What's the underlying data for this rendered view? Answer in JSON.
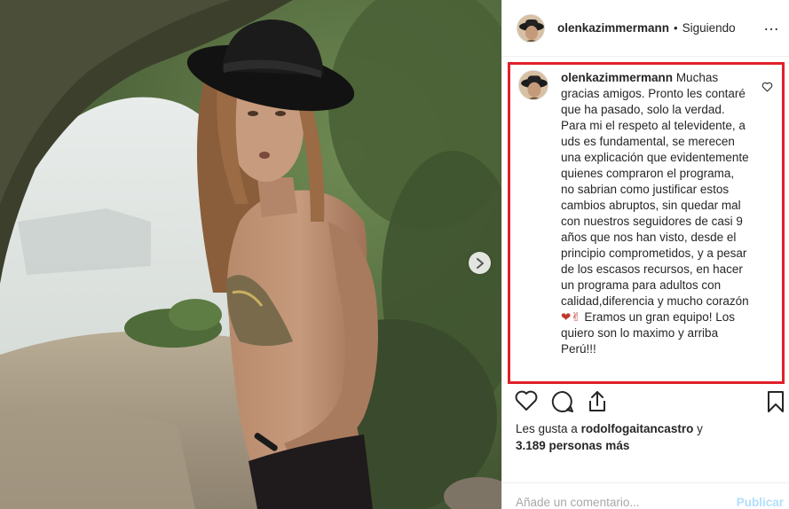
{
  "post": {
    "username": "olenkazimmermann",
    "separator": "•",
    "follow_status": "Siguiendo",
    "more_icon": "more-horizontal-icon"
  },
  "comment": {
    "username": "olenkazimmermann",
    "text_1": "Muchas gracias amigos. Pronto les contaré que ha pasado, solo la verdad. Para mi el respeto al televidente, a uds es fundamental, se merecen una explicación que evidentemente quienes compraron el programa, no sabrian como justificar estos cambios abruptos, sin quedar mal con nuestros seguidores de casi 9 años que nos han visto, desde el principio comprometidos, y a pesar de los escasos recursos, en hacer un programa para adultos con calidad,diferencia y mucho corazón",
    "emoji": "❤✌",
    "text_2": " Eramos un gran equipo! Los quiero son lo maximo y arriba Perú!!!"
  },
  "likes": {
    "prefix": "Les gusta a ",
    "user": "rodolfogaitancastro",
    "middle": " y",
    "count": "3.189 personas más"
  },
  "add_comment": {
    "placeholder": "Añade un comentario...",
    "publish_label": "Publicar"
  },
  "colors": {
    "highlight_border": "#e0202a",
    "publish_disabled": "#b2dffc",
    "text": "#262626"
  }
}
